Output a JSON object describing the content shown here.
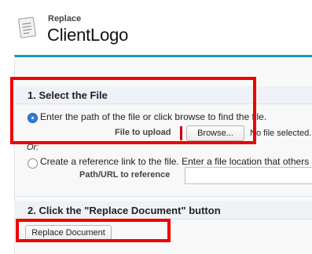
{
  "header": {
    "super_title": "Replace",
    "title": "ClientLogo",
    "icon": "document-icon"
  },
  "step1": {
    "title": "1. Select the File",
    "option_upload": {
      "text": "Enter the path of the file or click browse to find the file.",
      "selected": true
    },
    "file_label": "File to upload",
    "browse_label": "Browse...",
    "file_status": "No file selected.",
    "or_text": "Or:",
    "option_link": {
      "text": "Create a reference link to the file. Enter a file location that others c",
      "selected": false
    },
    "path_label": "Path/URL to reference",
    "path_value": ""
  },
  "step2": {
    "title": "2. Click the \"Replace Document\" button",
    "button_label": "Replace Document"
  },
  "colors": {
    "accent": "#1797c0",
    "highlight": "#ef0000",
    "radio_selected": "#2f7cd8"
  }
}
